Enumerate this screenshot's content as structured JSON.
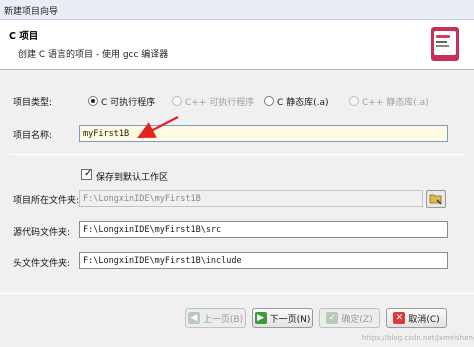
{
  "window": {
    "title": "新建项目向导"
  },
  "banner": {
    "heading": "C 项目",
    "description": "创建 C 语言的项目 - 使用 gcc 编译器"
  },
  "project_type": {
    "label": "项目类型:",
    "options": [
      {
        "label": "C 可执行程序",
        "selected": true,
        "enabled": true
      },
      {
        "label": "C++ 可执行程序",
        "selected": false,
        "enabled": false
      },
      {
        "label": "C 静态库(.a)",
        "selected": false,
        "enabled": true
      },
      {
        "label": "C++ 静态库(.a)",
        "selected": false,
        "enabled": false
      }
    ]
  },
  "project_name": {
    "label": "项目名称:",
    "value": "myFirst1B"
  },
  "save_default": {
    "label": "保存到默认工作区",
    "checked": true
  },
  "project_folder": {
    "label": "项目所在文件夹:",
    "value": "F:\\LongxinIDE\\myFirst1B"
  },
  "source_folder": {
    "label": "源代码文件夹:",
    "value": "F:\\LongxinIDE\\myFirst1B\\src"
  },
  "header_folder": {
    "label": "头文件文件夹:",
    "value": "F:\\LongxinIDE\\myFirst1B\\include"
  },
  "buttons": {
    "back": {
      "label": "上一页(B)",
      "icon": "back-arrow-icon",
      "enabled": false
    },
    "next": {
      "label": "下一页(N)",
      "icon": "next-arrow-icon",
      "enabled": true
    },
    "finish": {
      "label": "确定(Z)",
      "icon": "check-icon",
      "enabled": false
    },
    "cancel": {
      "label": "取消(C)",
      "icon": "cancel-x-icon",
      "enabled": true
    }
  },
  "watermark": "https://blog.csdn.net/jxmeisheng",
  "colors": {
    "annotation_arrow": "#e32222",
    "name_field_bg": "#fffbe0",
    "banner_logo": "#c7305a"
  }
}
